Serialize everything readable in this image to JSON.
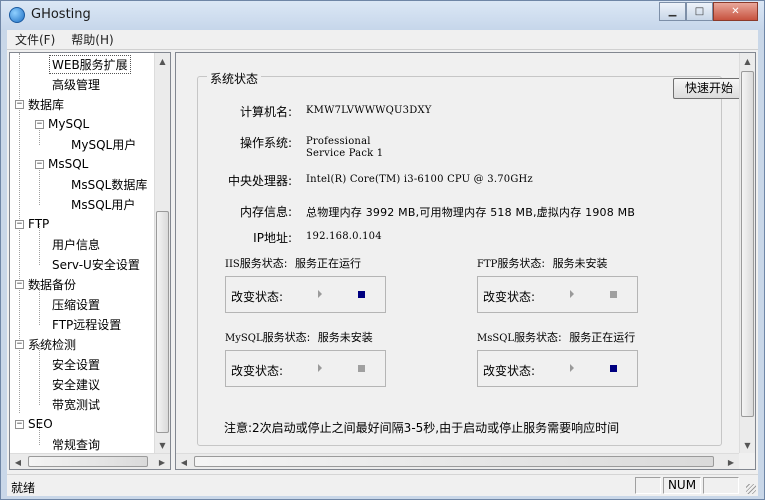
{
  "window": {
    "title": "GHosting",
    "minimize_icon": "minimize-icon",
    "maximize_icon": "maximize-icon",
    "close_icon": "close-icon"
  },
  "menu": [
    {
      "label": "文件(F)"
    },
    {
      "label": "帮助(H)"
    }
  ],
  "tree": [
    {
      "label": "WEB服务扩展",
      "selected": true
    },
    {
      "label": "高级管理"
    },
    {
      "label": "数据库",
      "expander": "⊟"
    },
    {
      "label": "MySQL",
      "expander": "⊟"
    },
    {
      "label": "MySQL用户"
    },
    {
      "label": "MsSQL",
      "expander": "⊟"
    },
    {
      "label": "MsSQL数据库"
    },
    {
      "label": "MsSQL用户"
    },
    {
      "label": "FTP",
      "expander": "⊟"
    },
    {
      "label": "用户信息"
    },
    {
      "label": "Serv-U安全设置"
    },
    {
      "label": "数据备份",
      "expander": "⊟"
    },
    {
      "label": "压缩设置"
    },
    {
      "label": "FTP远程设置"
    },
    {
      "label": "系统检测",
      "expander": "⊟"
    },
    {
      "label": "安全设置"
    },
    {
      "label": "安全建议"
    },
    {
      "label": "带宽测试"
    },
    {
      "label": "SEO",
      "expander": "⊟"
    },
    {
      "label": "常规查询"
    }
  ],
  "system_status": {
    "group_title": "系统状态",
    "quick_start": "快速开始",
    "computer_name_label": "计算机名:",
    "computer_name": "KMW7LVWWWQU3DXY",
    "os_label": "操作系统:",
    "os_line1": "Professional",
    "os_line2": "Service Pack 1",
    "cpu_label": "中央处理器:",
    "cpu": "Intel(R) Core(TM) i3-6100 CPU @ 3.70GHz",
    "memory_label": "内存信息:",
    "memory": "总物理内存 3992 MB,可用物理内存 518 MB,虚拟内存 1908 MB",
    "ip_label": "IP地址:",
    "ip": "192.168.0.104"
  },
  "services": {
    "iis": {
      "name": "IIS",
      "suffix": "服务状态:",
      "status": "服务正在运行",
      "change_label": "改变状态:",
      "running": true
    },
    "ftp": {
      "name": "FTP",
      "suffix": "服务状态:",
      "status": "服务未安装",
      "change_label": "改变状态:",
      "running": false
    },
    "mysql": {
      "name": "MySQL",
      "suffix": "服务状态:",
      "status": "服务未安装",
      "change_label": "改变状态:",
      "running": false
    },
    "mssql": {
      "name": "MsSQL",
      "suffix": "服务状态:",
      "status": "服务正在运行",
      "change_label": "改变状态:",
      "running": true
    }
  },
  "note": "注意:2次启动或停止之间最好间隔3-5秒,由于启动或停止服务需要响应时间",
  "statusbar": {
    "text": "就绪",
    "num": "NUM"
  },
  "colors": {
    "running_indicator": "#000080",
    "stopped_indicator": "#a0a0a0"
  }
}
